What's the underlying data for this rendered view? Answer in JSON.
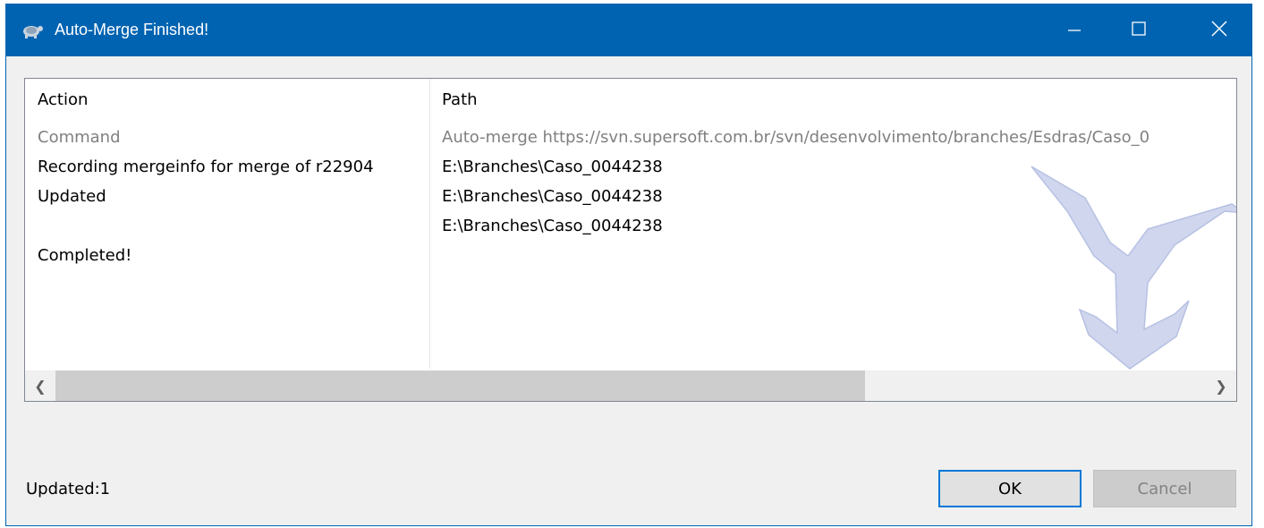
{
  "window": {
    "title": "Auto-Merge Finished!",
    "colors": {
      "titlebar": "#0063b1",
      "body": "#f0f0f0",
      "accent": "#0078d7"
    }
  },
  "list": {
    "columns": [
      "Action",
      "Path"
    ],
    "rows": [
      {
        "action": "Command",
        "path": "Auto-merge https://svn.supersoft.com.br/svn/desenvolvimento/branches/Esdras/Caso_0",
        "muted": true
      },
      {
        "action": "Recording mergeinfo for merge of r22904",
        "path": "E:\\Branches\\Caso_0044238"
      },
      {
        "action": "Updated",
        "path": "E:\\Branches\\Caso_0044238"
      },
      {
        "action": "",
        "path": "E:\\Branches\\Caso_0044238"
      },
      {
        "action": "Completed!",
        "path": ""
      }
    ]
  },
  "status": "Updated:1",
  "buttons": {
    "ok": "OK",
    "cancel": "Cancel"
  },
  "icons": [
    "app-icon",
    "minimize-icon",
    "maximize-icon",
    "close-icon",
    "scroll-left-icon",
    "scroll-right-icon",
    "merge-arrow-watermark"
  ]
}
